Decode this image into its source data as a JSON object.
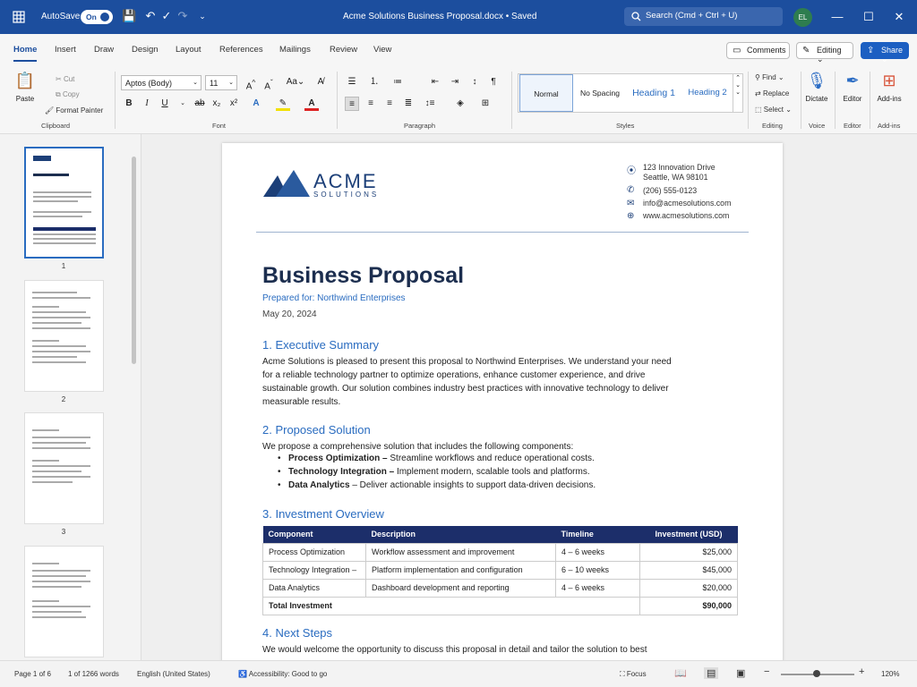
{
  "titlebar": {
    "autosave_label": "AutoSave",
    "autosave_state": "On",
    "doc_title": "Acme Solutions Business Proposal.docx • Saved",
    "search_placeholder": "Search (Cmd + Ctrl + U)",
    "user_initials": "EL"
  },
  "tabs": [
    "Home",
    "Insert",
    "Draw",
    "Design",
    "Layout",
    "References",
    "Mailings",
    "Review",
    "View"
  ],
  "tab_buttons": {
    "comments": "Comments",
    "editing": "Editing",
    "share": "Share"
  },
  "ribbon": {
    "clipboard": {
      "paste": "Paste",
      "cut": "Cut",
      "copy": "Copy",
      "format_painter": "Format Painter",
      "label": "Clipboard"
    },
    "font": {
      "name": "Aptos (Body)",
      "size": "11",
      "label": "Font"
    },
    "paragraph": {
      "label": "Paragraph"
    },
    "styles": {
      "items": [
        "Normal",
        "No Spacing",
        "Heading 1",
        "Heading 2"
      ],
      "label": "Styles"
    },
    "editing": {
      "find": "Find",
      "replace": "Replace",
      "select": "Select",
      "label": "Editing"
    },
    "voice": {
      "dictate": "Dictate",
      "label": "Voice"
    },
    "editor": {
      "editor": "Editor",
      "label": "Editor"
    },
    "addins": {
      "addins": "Add-ins",
      "label": "Add-ins"
    }
  },
  "nav": {
    "pages": [
      "1",
      "2",
      "3"
    ]
  },
  "document": {
    "logo_name": "ACME",
    "logo_sub": "SOLUTIONS",
    "contact": {
      "address1": "123 Innovation Drive",
      "address2": "Seattle, WA 98101",
      "phone": "(206) 555-0123",
      "email": "info@acmesolutions.com",
      "web": "www.acmesolutions.com"
    },
    "title": "Business Proposal",
    "prepared_for": "Prepared for: Northwind Enterprises",
    "date": "May 20, 2024",
    "sections": {
      "s1_heading": "1. Executive Summary",
      "s1_body": "Acme Solutions is pleased to present this proposal to Northwind Enterprises. We understand your need for a reliable technology partner to optimize operations, enhance customer experience, and drive sustainable growth. Our solution combines industry best practices with innovative technology to deliver measurable results.",
      "s2_heading": "2. Proposed Solution",
      "s2_body": "We propose a comprehensive solution that includes the following components:",
      "s2_bullets": [
        {
          "bold": "Process Optimization –",
          "text": "Streamline workflows and reduce operational costs."
        },
        {
          "bold": "Technology Integration –",
          "text": "Implement modern, scalable tools and platforms."
        },
        {
          "bold": "Data Analytics",
          "text": "– Deliver actionable insights to support data-driven decisions."
        }
      ],
      "s3_heading": "3. Investment Overview",
      "table": {
        "headers": [
          "Component",
          "Description",
          "Timeline",
          "Investment (USD)"
        ],
        "rows": [
          [
            "Process Optimization",
            "Workflow assessment and improvement",
            "4 – 6 weeks",
            "$25,000"
          ],
          [
            "Technology Integration –",
            "Platform implementation and configuration",
            "6 – 10 weeks",
            "$45,000"
          ],
          [
            "Data Analytics",
            "Dashboard development and reporting",
            "4 – 6 weeks",
            "$20,000"
          ]
        ],
        "total_label": "Total Investment",
        "total_value": "$90,000"
      },
      "s4_heading": "4. Next Steps",
      "s4_body": "We would welcome the opportunity to discuss this proposal in detail and tailor the solution to best"
    }
  },
  "status": {
    "page": "Page 1 of 6",
    "words": "1 of 1266 words",
    "language": "English (United States)",
    "accessibility": "Accessibility: Good to go",
    "focus": "Focus",
    "zoom": "120%"
  },
  "colors": {
    "accent": "#1c4e9e",
    "heading": "#2a6cc0",
    "table_header": "#1c2e6a"
  }
}
